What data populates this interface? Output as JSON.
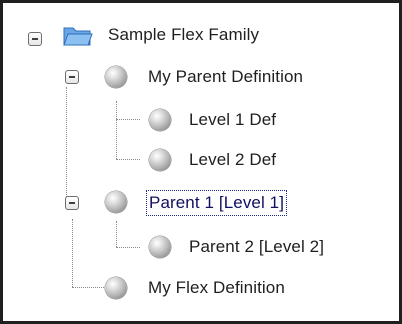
{
  "tree": {
    "root": {
      "label": "Sample Flex Family",
      "icon": "open-folder-icon",
      "expanded": true
    },
    "nodes": [
      {
        "label": "My Parent Definition",
        "icon": "gray-sphere-icon",
        "expanded": true
      },
      {
        "label": "Level 1 Def",
        "icon": "gray-sphere-icon"
      },
      {
        "label": "Level 2 Def",
        "icon": "gray-sphere-icon"
      },
      {
        "label": "Parent 1 [Level 1]",
        "icon": "gray-sphere-icon",
        "expanded": true,
        "selected": true
      },
      {
        "label": "Parent 2 [Level 2]",
        "icon": "gray-sphere-icon"
      },
      {
        "label": "My Flex Definition",
        "icon": "gray-sphere-icon"
      }
    ]
  },
  "colors": {
    "border": "#202020",
    "guide": "#8a8a8a",
    "text": "#1f1f1f",
    "folder": "#4a8fd8"
  }
}
